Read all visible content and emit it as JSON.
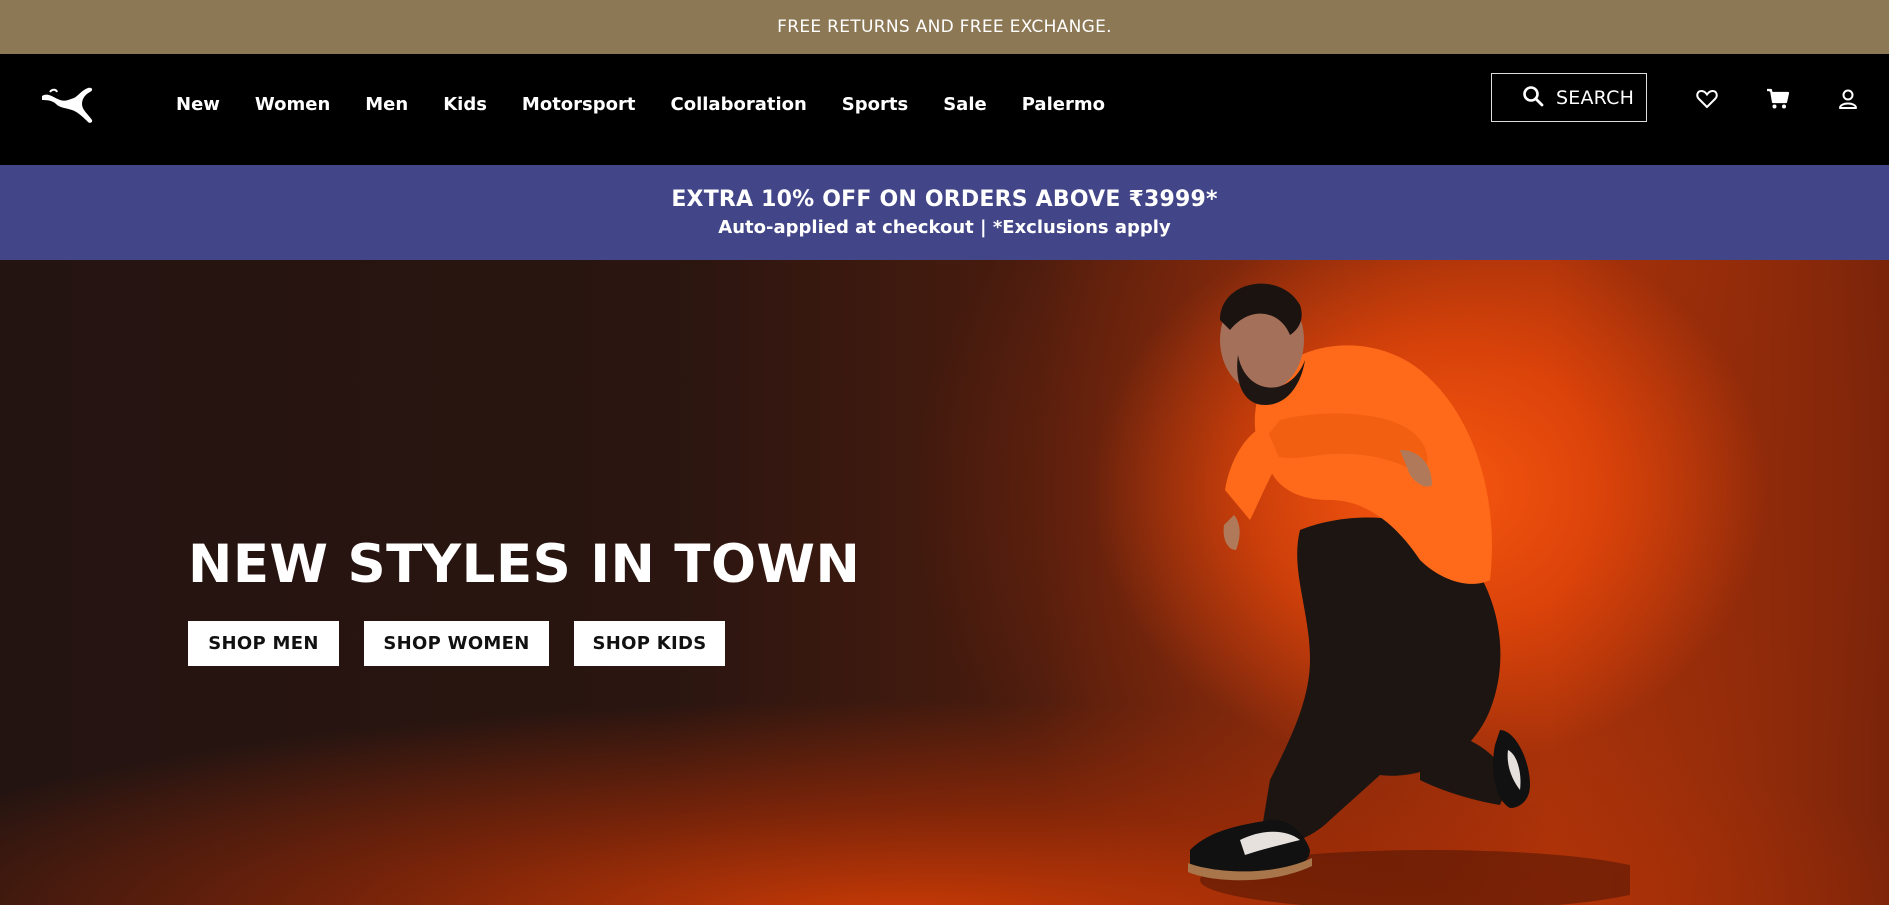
{
  "colors": {
    "top_banner_bg": "#8c7855",
    "navbar_bg": "#000000",
    "promo_bg": "#424587",
    "hero_accent": "#ff5a0f",
    "cta_bg": "#ffffff"
  },
  "top_banner": {
    "text": "FREE RETURNS AND FREE EXCHANGE."
  },
  "navbar": {
    "logo_icon": "puma-cat-logo-icon",
    "links": [
      {
        "label": "New"
      },
      {
        "label": "Women"
      },
      {
        "label": "Men"
      },
      {
        "label": "Kids"
      },
      {
        "label": "Motorsport"
      },
      {
        "label": "Collaboration"
      },
      {
        "label": "Sports"
      },
      {
        "label": "Sale"
      },
      {
        "label": "Palermo"
      }
    ],
    "search": {
      "label": "SEARCH",
      "icon": "search-icon"
    },
    "icons": [
      "heart-icon",
      "cart-icon",
      "user-icon"
    ]
  },
  "promo": {
    "headline": "EXTRA 10% OFF ON ORDERS ABOVE ₹3999*",
    "sub": "Auto-applied at checkout | *Exclusions apply"
  },
  "hero": {
    "title": "NEW STYLES IN TOWN",
    "buttons": [
      {
        "label": "SHOP MEN"
      },
      {
        "label": "SHOP WOMEN"
      },
      {
        "label": "SHOP KIDS"
      }
    ]
  }
}
